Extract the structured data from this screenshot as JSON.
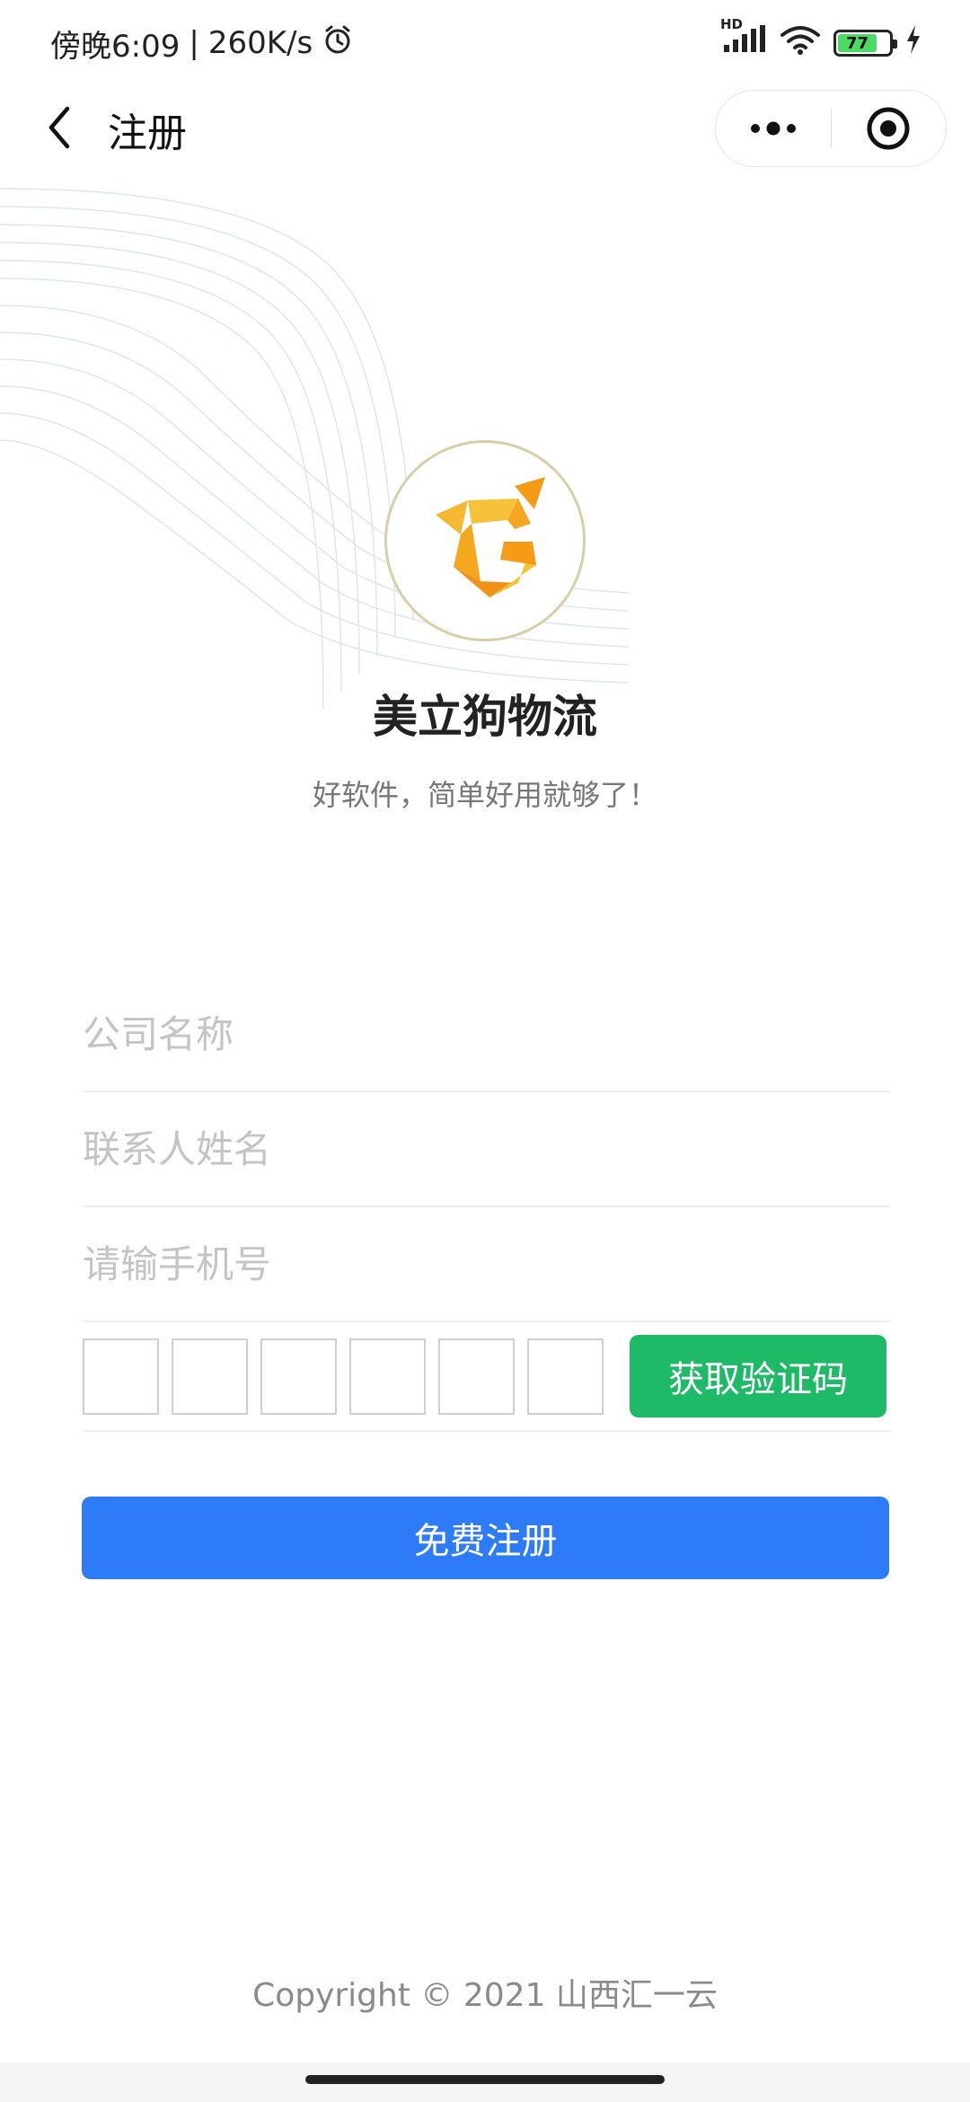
{
  "status_bar": {
    "time": "傍晚6:09",
    "separator": "|",
    "speed": "260K/s",
    "network": "HD",
    "battery": "77"
  },
  "nav": {
    "title": "注册"
  },
  "brand": {
    "name": "美立狗物流",
    "slogan": "好软件，简单好用就够了！"
  },
  "form": {
    "company_placeholder": "公司名称",
    "contact_placeholder": "联系人姓名",
    "phone_placeholder": "请输手机号",
    "code_box_count": 6,
    "get_code_label": "获取验证码",
    "register_label": "免费注册"
  },
  "footer": {
    "copyright": "Copyright © 2021 山西汇一云"
  },
  "colors": {
    "green_button": "#1fba68",
    "blue_button": "#2e7bf7",
    "logo_orange": "#f5a623"
  }
}
